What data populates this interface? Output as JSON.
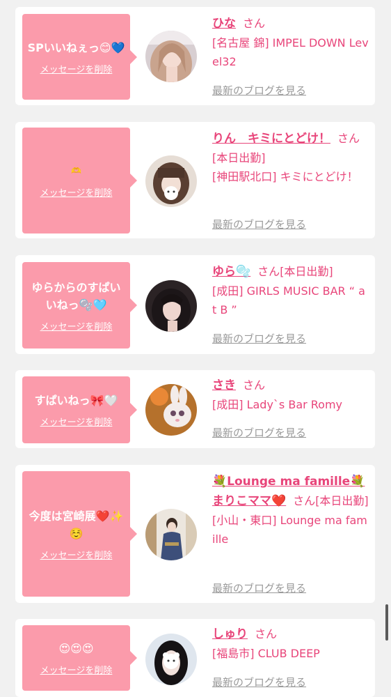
{
  "colors": {
    "accent": "#e8457a",
    "bubble": "#fb9bab",
    "muted": "#9a9a9a",
    "background": "#f1f1f1"
  },
  "delete_label": "メッセージを削除",
  "blog_label": "最新のブログを見る",
  "san_label": "さん",
  "items": [
    {
      "message": "SPいいねぇっ😊💙",
      "name": "ひな",
      "details": "[名古屋 錦] IMPEL DOWN Level32",
      "avatar_icon": "cast-photo-blonde"
    },
    {
      "message": "🫶",
      "name": "りん　キミにとどけ！",
      "details": "[本日出勤]\n[神田駅北口] キミにとどけ！",
      "avatar_icon": "cast-photo-masked"
    },
    {
      "message": "ゆらからのすぱいいねっ🫧🩵",
      "name": "ゆら🫧",
      "details": "[本日出勤]\n[成田] GIRLS MUSIC BAR “ at B ”",
      "avatar_icon": "cast-photo-dark-hair"
    },
    {
      "message": "すぱいねっ🎀🤍",
      "name": "さき",
      "details": "[成田] Lady`s Bar Romy",
      "avatar_icon": "cast-photo-bunny"
    },
    {
      "message": "今度は宮崎展❤️✨☺️",
      "name": "💐Lounge ma famille💐まりこママ❤️",
      "details": "[本日出勤]\n[小山・東口] Lounge ma famille",
      "avatar_icon": "cast-photo-kimono"
    },
    {
      "message": "😍😍😍",
      "name": "しゅり",
      "details": "[福島市] CLUB DEEP",
      "avatar_icon": "cast-photo-bear-sticker"
    }
  ]
}
